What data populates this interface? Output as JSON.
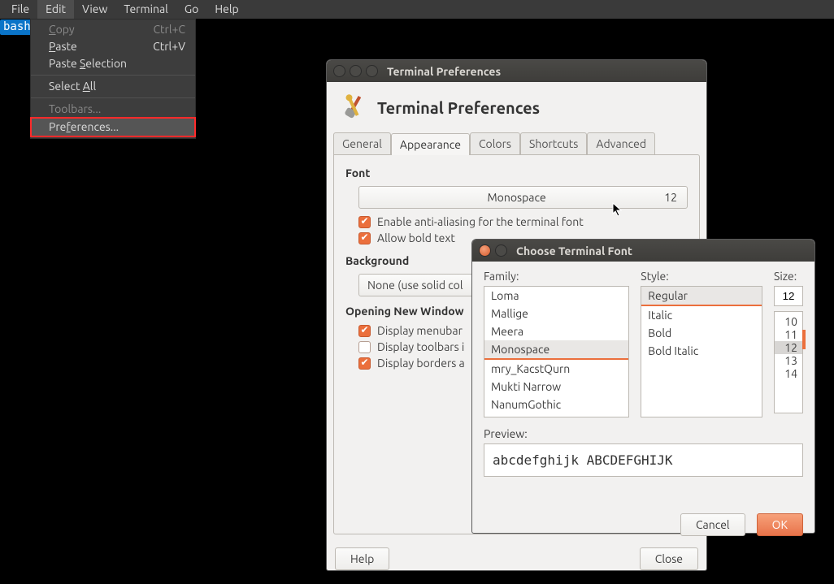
{
  "menubar": {
    "items": [
      "File",
      "Edit",
      "View",
      "Terminal",
      "Go",
      "Help"
    ],
    "open_index": 1
  },
  "bash_tag": "bash",
  "edit_menu": {
    "items": [
      {
        "label": "Copy",
        "accel": "Ctrl+C",
        "disabled": true,
        "ul": 0
      },
      {
        "label": "Paste",
        "accel": "Ctrl+V",
        "disabled": false,
        "ul": 0
      },
      {
        "label": "Paste Selection",
        "accel": "",
        "disabled": false,
        "ul": 6
      },
      {
        "sep": true
      },
      {
        "label": "Select All",
        "accel": "",
        "disabled": false,
        "ul": 7
      },
      {
        "sep": true
      },
      {
        "label": "Toolbars...",
        "accel": "",
        "disabled": true
      },
      {
        "label": "Preferences...",
        "accel": "",
        "disabled": false,
        "ul": 3,
        "highlight": true
      }
    ]
  },
  "prefs": {
    "win_title": "Terminal Preferences",
    "header": "Terminal Preferences",
    "tabs": [
      "General",
      "Appearance",
      "Colors",
      "Shortcuts",
      "Advanced"
    ],
    "active_tab": 1,
    "font_section_label": "Font",
    "font_button_name": "Monospace",
    "font_button_size": "12",
    "chk_anti_alias": "Enable anti-aliasing for the terminal font",
    "chk_bold": "Allow bold text",
    "background_section_label": "Background",
    "background_value": "None (use solid col",
    "opening_section_label": "Opening New Window",
    "chk_menubar": "Display menubar",
    "chk_toolbars": "Display toolbars i",
    "chk_borders": "Display borders a",
    "help_btn": "Help",
    "close_btn": "Close"
  },
  "fontdlg": {
    "win_title": "Choose Terminal Font",
    "family_label": "Family:",
    "style_label": "Style:",
    "size_label": "Size:",
    "families": [
      "Loma",
      "Mallige",
      "Meera",
      "Monospace",
      "mry_KacstQurn",
      "Mukti Narrow",
      "NanumGothic"
    ],
    "family_selected": 3,
    "styles": [
      "Regular",
      "Italic",
      "Bold",
      "Bold Italic"
    ],
    "style_selected": 0,
    "size_value": "12",
    "sizes": [
      "10",
      "11",
      "12",
      "13",
      "14"
    ],
    "size_selected": 2,
    "preview_label": "Preview:",
    "preview_text": "abcdefghijk ABCDEFGHIJK",
    "cancel_btn": "Cancel",
    "ok_btn": "OK"
  }
}
